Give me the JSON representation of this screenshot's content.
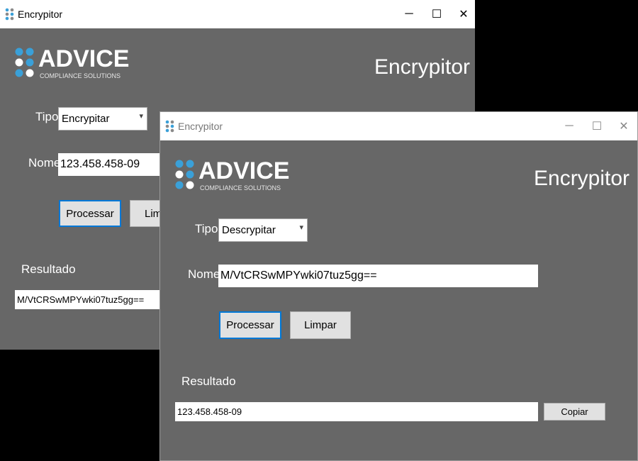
{
  "windows": [
    {
      "title": "Encrypitor",
      "logo": {
        "word": "ADVICE",
        "subtitle": "COMPLIANCE SOLUTIONS"
      },
      "heading": "Encrypitor",
      "tipo_label": "Tipo:",
      "tipo_value": "Encrypitar",
      "nome_label": "Nome:",
      "nome_value": "123.458.458-09",
      "processar_label": "Processar",
      "limpar_label": "Limpar",
      "resultado_label": "Resultado",
      "resultado_value": "M/VtCRSwMPYwki07tuz5gg=="
    },
    {
      "title": "Encrypitor",
      "logo": {
        "word": "ADVICE",
        "subtitle": "COMPLIANCE SOLUTIONS"
      },
      "heading": "Encrypitor",
      "tipo_label": "Tipo:",
      "tipo_value": "Descrypitar",
      "nome_label": "Nome:",
      "nome_value": "M/VtCRSwMPYwki07tuz5gg==",
      "processar_label": "Processar",
      "limpar_label": "Limpar",
      "resultado_label": "Resultado",
      "resultado_value": "123.458.458-09",
      "copiar_label": "Copiar"
    }
  ],
  "titlebar_buttons": {
    "minimize": "─",
    "maximize": "☐",
    "close": "✕"
  },
  "icons": {
    "app": "app-logo-icon",
    "chevron": "▾"
  },
  "colors": {
    "window_bg": "#676767",
    "desktop": "#000000",
    "accent": "#0078d7",
    "logo_blue": "#3aa0d8"
  }
}
